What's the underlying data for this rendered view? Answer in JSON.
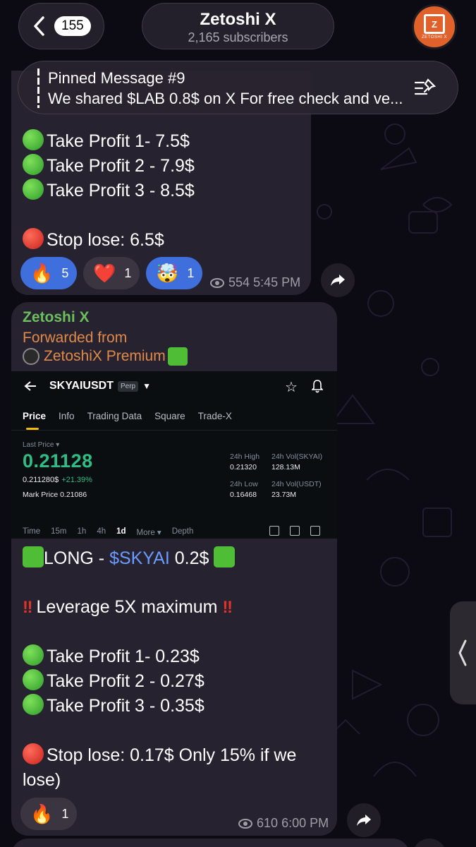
{
  "header": {
    "unread_count": "155",
    "channel_name": "Zetoshi X",
    "subscribers": "2,165 subscribers",
    "avatar_label": "ZETOSHI X"
  },
  "pinned": {
    "title": "Pinned Message #9",
    "text": "We shared $LAB 0.8$ on X For free check and ve..."
  },
  "message1": {
    "lines": [
      "Take Profit 1- 7.5$",
      "Take Profit 2 - 7.9$",
      "Take Profit 3 - 8.5$",
      "Stop lose: 6.5$"
    ],
    "reactions": [
      {
        "emoji": "🔥",
        "count": "5",
        "style": "blue"
      },
      {
        "emoji": "❤️",
        "count": "1",
        "style": "gray"
      },
      {
        "emoji": "🤯",
        "count": "1",
        "style": "blue"
      }
    ],
    "views": "554",
    "time": "5:45 PM"
  },
  "message2": {
    "sender": "Zetoshi X",
    "forwarded_label": "Forwarded from",
    "forwarded_channel": "ZetoshiX Premium",
    "screenshot": {
      "pair": "SKYAIUSDT",
      "perp_badge": "Perp",
      "tabs": [
        "Price",
        "Info",
        "Trading Data",
        "Square",
        "Trade-X"
      ],
      "last_price_label": "Last Price",
      "last_price": "0.21128",
      "sub_price": "0.211280$",
      "change": "+21.39%",
      "mark_price": "Mark Price 0.21086",
      "high_label": "24h High",
      "high_value": "0.21320",
      "vol_sky_label": "24h Vol(SKYAI)",
      "vol_sky_value": "128.13M",
      "low_label": "24h Low",
      "low_value": "0.16468",
      "vol_usdt_label": "24h Vol(USDT)",
      "vol_usdt_value": "23.73M",
      "intervals": [
        "Time",
        "15m",
        "1h",
        "4h",
        "1d",
        "More ▾",
        "Depth"
      ]
    },
    "long_prefix": "LONG  - ",
    "long_ticker": "$SKYAI",
    "long_price": " 0.2$",
    "leverage": "Leverage 5X maximum",
    "tp_lines": [
      "Take Profit 1- 0.23$",
      "Take Profit 2 - 0.27$",
      "Take Profit 3 - 0.35$"
    ],
    "stop_line1": "Stop lose: 0.17$ Only 15% if we",
    "stop_line2": "lose)",
    "reaction": {
      "emoji": "🔥",
      "count": "1"
    },
    "views": "610",
    "time": "6:00 PM"
  },
  "colors": {
    "accent_blue": "#3f6fdc",
    "sender_green": "#6bbf5c",
    "forward_orange": "#e08a4a",
    "price_green": "#2ebd85"
  }
}
